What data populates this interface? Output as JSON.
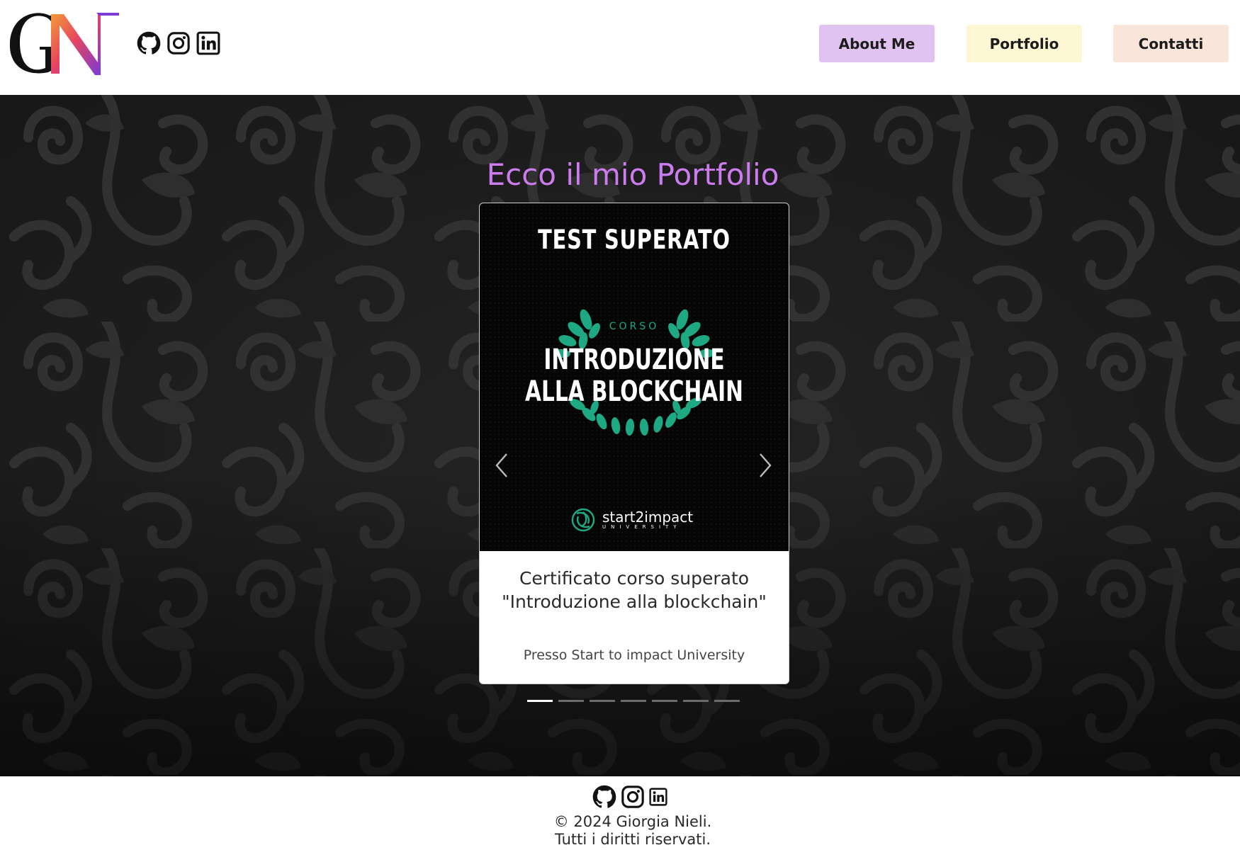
{
  "header": {
    "logo_text": "GN",
    "social": [
      "github-icon",
      "instagram-icon",
      "linkedin-icon"
    ],
    "nav": {
      "about": "About Me",
      "portfolio": "Portfolio",
      "contatti": "Contatti"
    },
    "nav_colors": {
      "about": "#e1c3f1",
      "portfolio": "#fdf8d3",
      "contatti": "#f9e5da"
    }
  },
  "hero": {
    "title": "Ecco il mio Portfolio",
    "title_color": "#cd7cf0",
    "card": {
      "image": {
        "top_text": "TEST SUPERATO",
        "badge_label": "CORSO",
        "line1": "INTRODUZIONE",
        "line2": "ALLA BLOCKCHAIN",
        "brand": "start2impact",
        "brand_sub": "UNIVERSITY",
        "accent": "#1fa884"
      },
      "title": "Certificato corso superato \"Introduzione alla blockchain\"",
      "subtitle": "Presso Start to impact University"
    },
    "carousel": {
      "slides": 7,
      "active_index": 0
    }
  },
  "footer": {
    "social": [
      "github-icon",
      "instagram-icon",
      "linkedin-icon"
    ],
    "copyright_line1": "© 2024 Giorgia Nieli.",
    "copyright_line2": "Tutti i diritti riservati."
  }
}
